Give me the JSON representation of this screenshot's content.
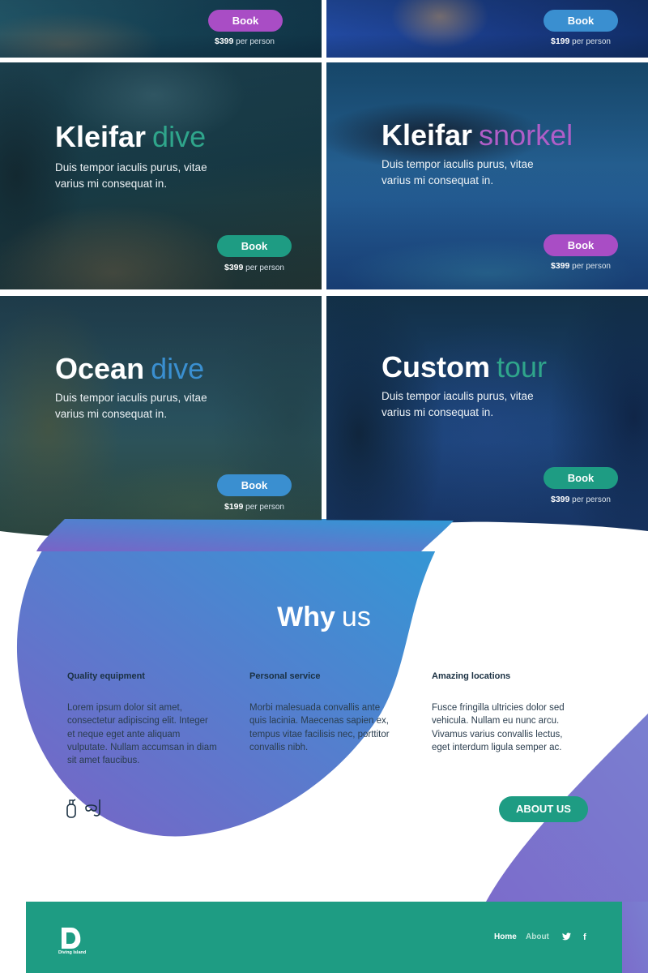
{
  "colors": {
    "teal": "#1e9c83",
    "purple": "#a94dc5",
    "blue": "#3a8fd0",
    "dark_text": "#1a3042",
    "gradient_start": "#7a63c6",
    "gradient_end": "#2f9ad6"
  },
  "tours": [
    {
      "book_label": "Book",
      "price": "$399",
      "price_suffix": "per person",
      "button_color": "purple"
    },
    {
      "book_label": "Book",
      "price": "$199",
      "price_suffix": "per person",
      "button_color": "blue"
    },
    {
      "title_strong": "Kleifar",
      "title_light": "dive",
      "accent": "teal",
      "description": "Duis tempor iaculis purus, vitae varius mi consequat in.",
      "book_label": "Book",
      "price": "$399",
      "price_suffix": "per person"
    },
    {
      "title_strong": "Kleifar",
      "title_light": "snorkel",
      "accent": "purple",
      "description": "Duis tempor iaculis purus, vitae varius mi consequat in.",
      "book_label": "Book",
      "price": "$399",
      "price_suffix": "per person"
    },
    {
      "title_strong": "Ocean",
      "title_light": "dive",
      "accent": "blue",
      "description": "Duis tempor iaculis purus, vitae varius mi consequat in.",
      "book_label": "Book",
      "price": "$199",
      "price_suffix": "per person"
    },
    {
      "title_strong": "Custom",
      "title_light": "tour",
      "accent": "teal",
      "description": "Duis tempor iaculis purus, vitae varius mi consequat in.",
      "book_label": "Book",
      "price": "$399",
      "price_suffix": "per person"
    }
  ],
  "why_us": {
    "title_strong": "Why",
    "title_light": "us",
    "features": [
      {
        "title": "Quality equipment",
        "text": "Lorem ipsum dolor sit amet, consectetur adipiscing elit. Integer et neque eget ante aliquam vulputate. Nullam accumsan in diam sit amet faucibus."
      },
      {
        "title": "Personal service",
        "text": "Morbi malesuada convallis ante quis lacinia. Maecenas sapien ex, tempus vitae facilisis nec, porttitor convallis nibh."
      },
      {
        "title": "Amazing locations",
        "text": "Fusce fringilla ultricies dolor sed vehicula. Nullam eu nunc arcu. Vivamus varius convallis lectus, eget interdum ligula semper ac."
      }
    ],
    "icons": [
      "oxygen-tank-icon",
      "snorkel-mask-icon"
    ],
    "about_button": "ABOUT US"
  },
  "footer": {
    "logo_text": "Diving Island",
    "nav": [
      {
        "label": "Home",
        "active": true
      },
      {
        "label": "About",
        "active": false
      }
    ],
    "social": [
      {
        "icon": "twitter-icon",
        "glyph": "🐦"
      },
      {
        "icon": "facebook-icon",
        "glyph": "f"
      }
    ]
  }
}
